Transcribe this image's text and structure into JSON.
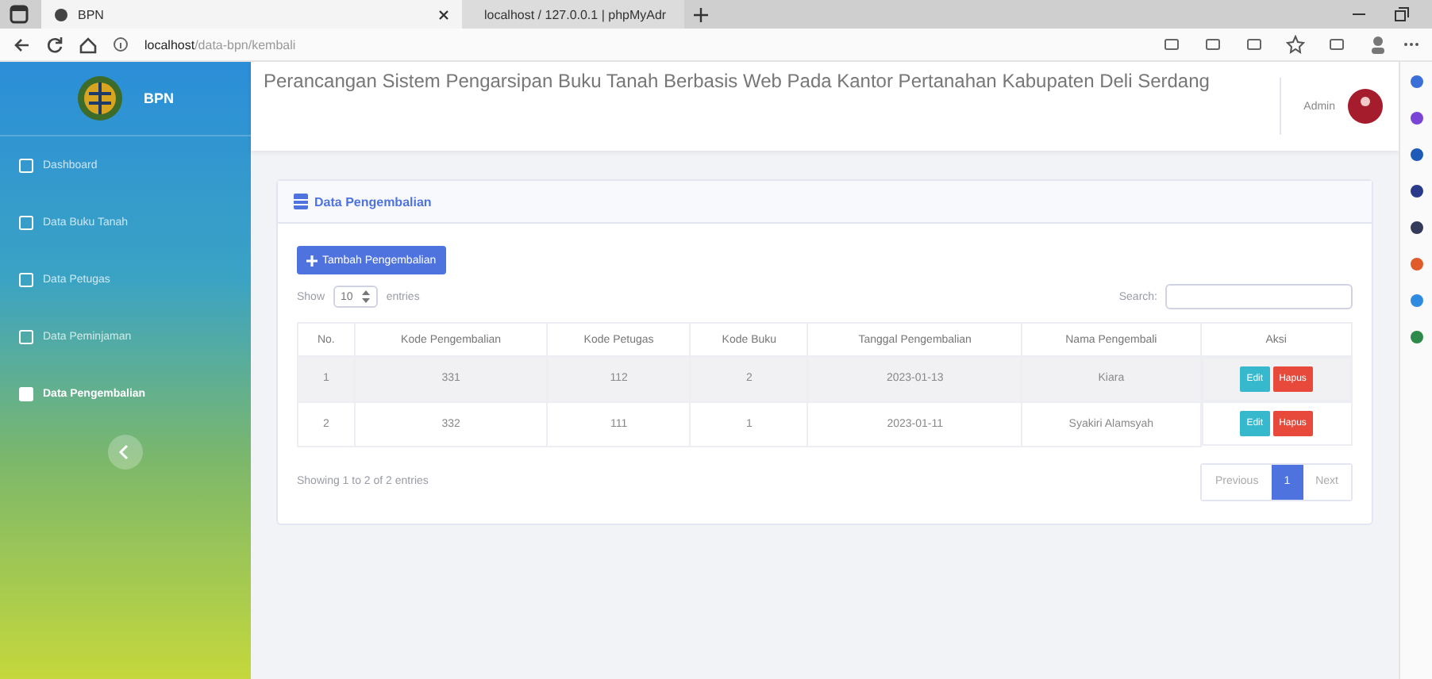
{
  "browser": {
    "tabs": [
      {
        "label": "BPN",
        "selected": true
      },
      {
        "label": "localhost / 127.0.0.1 | phpMyAdr",
        "selected": false
      }
    ],
    "address": {
      "host": "localhost",
      "path": "/data-bpn/kembali"
    }
  },
  "sidebar": {
    "brand": "BPN",
    "items": [
      {
        "label": "Dashboard",
        "selected": false
      },
      {
        "label": "Data Buku Tanah",
        "selected": false
      },
      {
        "label": "Data Petugas",
        "selected": false
      },
      {
        "label": "Data Peminjaman",
        "selected": false
      },
      {
        "label": "Data Pengembalian",
        "selected": true
      }
    ]
  },
  "topbar": {
    "title": "Perancangan Sistem Pengarsipan Buku Tanah Berbasis Web Pada Kantor Pertanahan Kabupaten Deli Serdang",
    "user": "Admin"
  },
  "card": {
    "title": "Data Pengembalian",
    "add_button": "Tambah Pengembalian",
    "show_label": "Show",
    "page_size": "10",
    "entries_label": "entries",
    "search_label": "Search:",
    "table": {
      "columns": [
        "No.",
        "Kode Pengembalian",
        "Kode Petugas",
        "Kode Buku",
        "Tanggal Pengembalian",
        "Nama Pengembali",
        "Aksi"
      ],
      "rows": [
        {
          "cells": [
            "1",
            "331",
            "112",
            "2",
            "2023-01-13",
            "Kiara"
          ],
          "actions": [
            "Edit",
            "Hapus"
          ]
        },
        {
          "cells": [
            "2",
            "332",
            "111",
            "1",
            "2023-01-11",
            "Syakiri Alamsyah"
          ],
          "actions": [
            "Edit",
            "Hapus"
          ]
        }
      ]
    },
    "info": "Showing 1 to 2 of 2 entries",
    "pagination": [
      {
        "label": "Previous",
        "selected": false
      },
      {
        "label": "1",
        "selected": true
      },
      {
        "label": "Next",
        "selected": false
      }
    ]
  }
}
